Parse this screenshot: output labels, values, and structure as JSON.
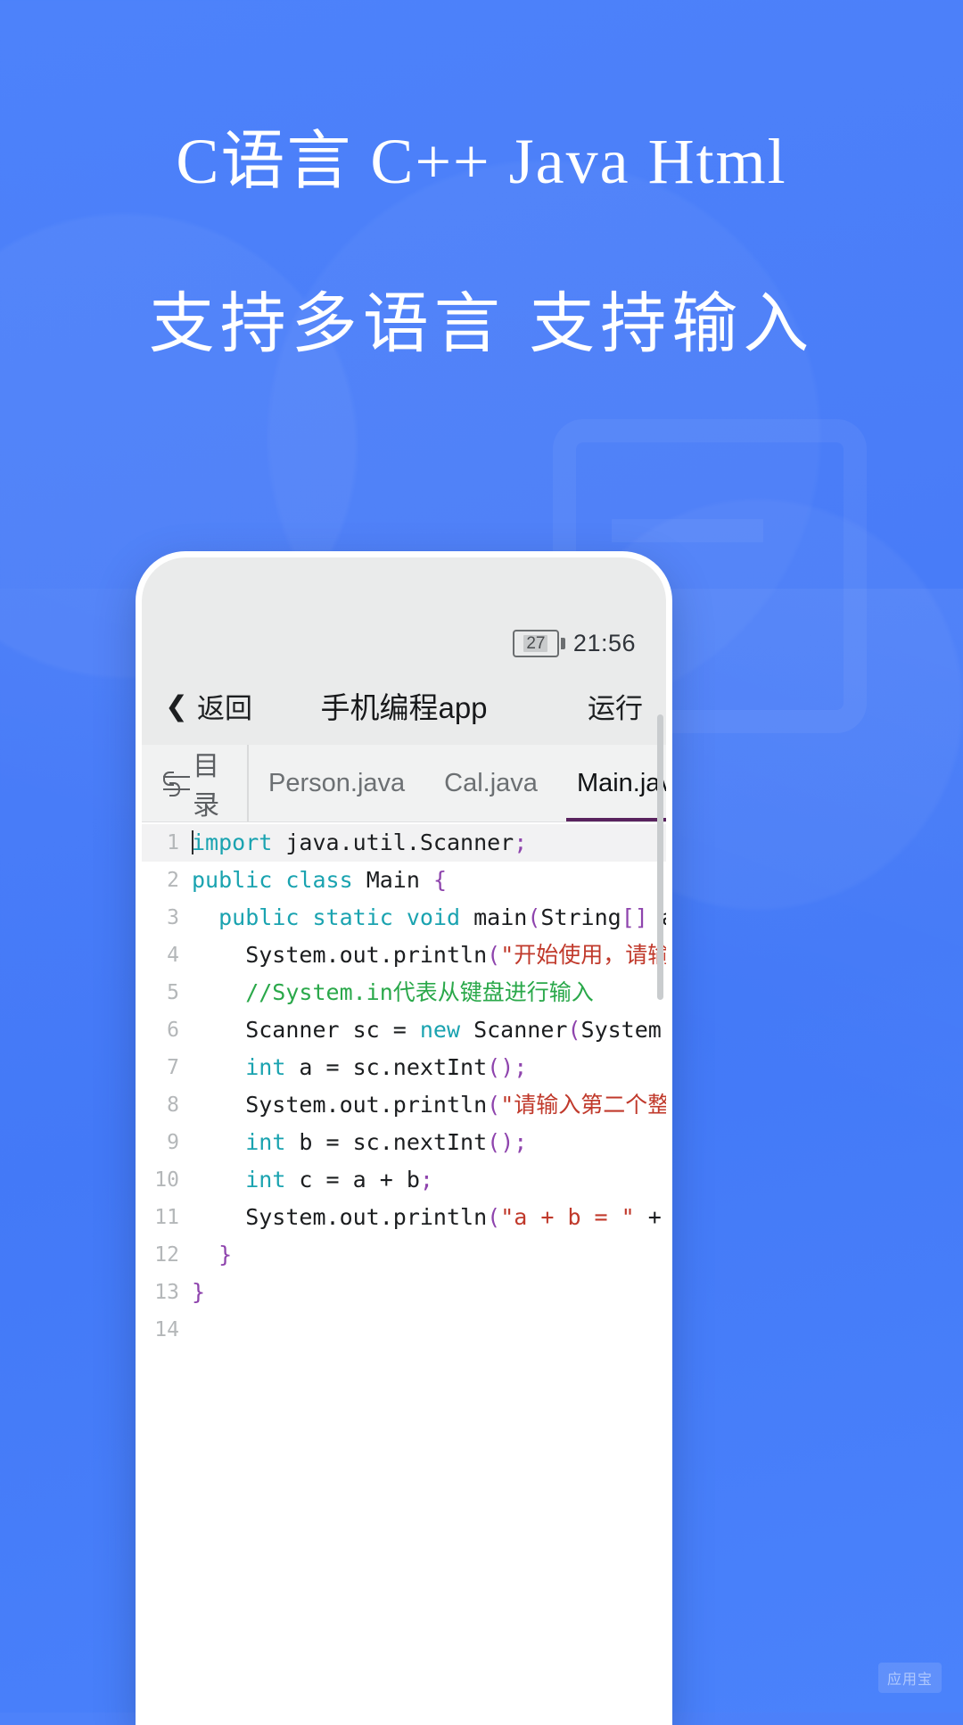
{
  "promo": {
    "headline_1": "C语言 C++ Java Html",
    "headline_2": "支持多语言 支持输入",
    "background_color": "#4a7df8",
    "watermark": "应用宝"
  },
  "phone": {
    "statusbar": {
      "battery_percent": "27",
      "time": "21:56"
    },
    "navbar": {
      "back_label": "返回",
      "back_icon": "chevron-left-icon",
      "title": "手机编程app",
      "run_label": "运行"
    },
    "tabbar": {
      "directory_label": "目录",
      "directory_icon": "swap-icon",
      "tabs": [
        {
          "label": "Person.java",
          "active": false
        },
        {
          "label": "Cal.java",
          "active": false
        },
        {
          "label": "Main.java",
          "active": true
        }
      ],
      "active_underline_color": "#59235e"
    },
    "editor": {
      "file": "Main.java",
      "language": "java",
      "total_lines": 14,
      "lines": [
        {
          "n": "1",
          "text": "import java.util.Scanner;"
        },
        {
          "n": "2",
          "text": "public class Main {"
        },
        {
          "n": "3",
          "text": "  public static void main(String[] args){"
        },
        {
          "n": "4",
          "text": "    System.out.println(\"开始使用，请输入第一个整数吧。\");"
        },
        {
          "n": "5",
          "text": "    //System.in代表从键盘进行输入"
        },
        {
          "n": "6",
          "text": "    Scanner sc = new Scanner(System.in);"
        },
        {
          "n": "7",
          "text": "    int a = sc.nextInt();"
        },
        {
          "n": "8",
          "text": "    System.out.println(\"请输入第二个整数吧。\");"
        },
        {
          "n": "9",
          "text": "    int b = sc.nextInt();"
        },
        {
          "n": "10",
          "text": "    int c = a + b;"
        },
        {
          "n": "11",
          "text": "    System.out.println(\"a + b = \" + c);"
        },
        {
          "n": "12",
          "text": "  }"
        },
        {
          "n": "13",
          "text": "}"
        },
        {
          "n": "14",
          "text": ""
        }
      ],
      "syntax_colors": {
        "keyword": "#1aa3b0",
        "string": "#c0392b",
        "comment": "#2aa84a",
        "punctuation": "#8e44ad",
        "text": "#1b1d1f",
        "line_number": "#b4b7b9"
      }
    }
  }
}
